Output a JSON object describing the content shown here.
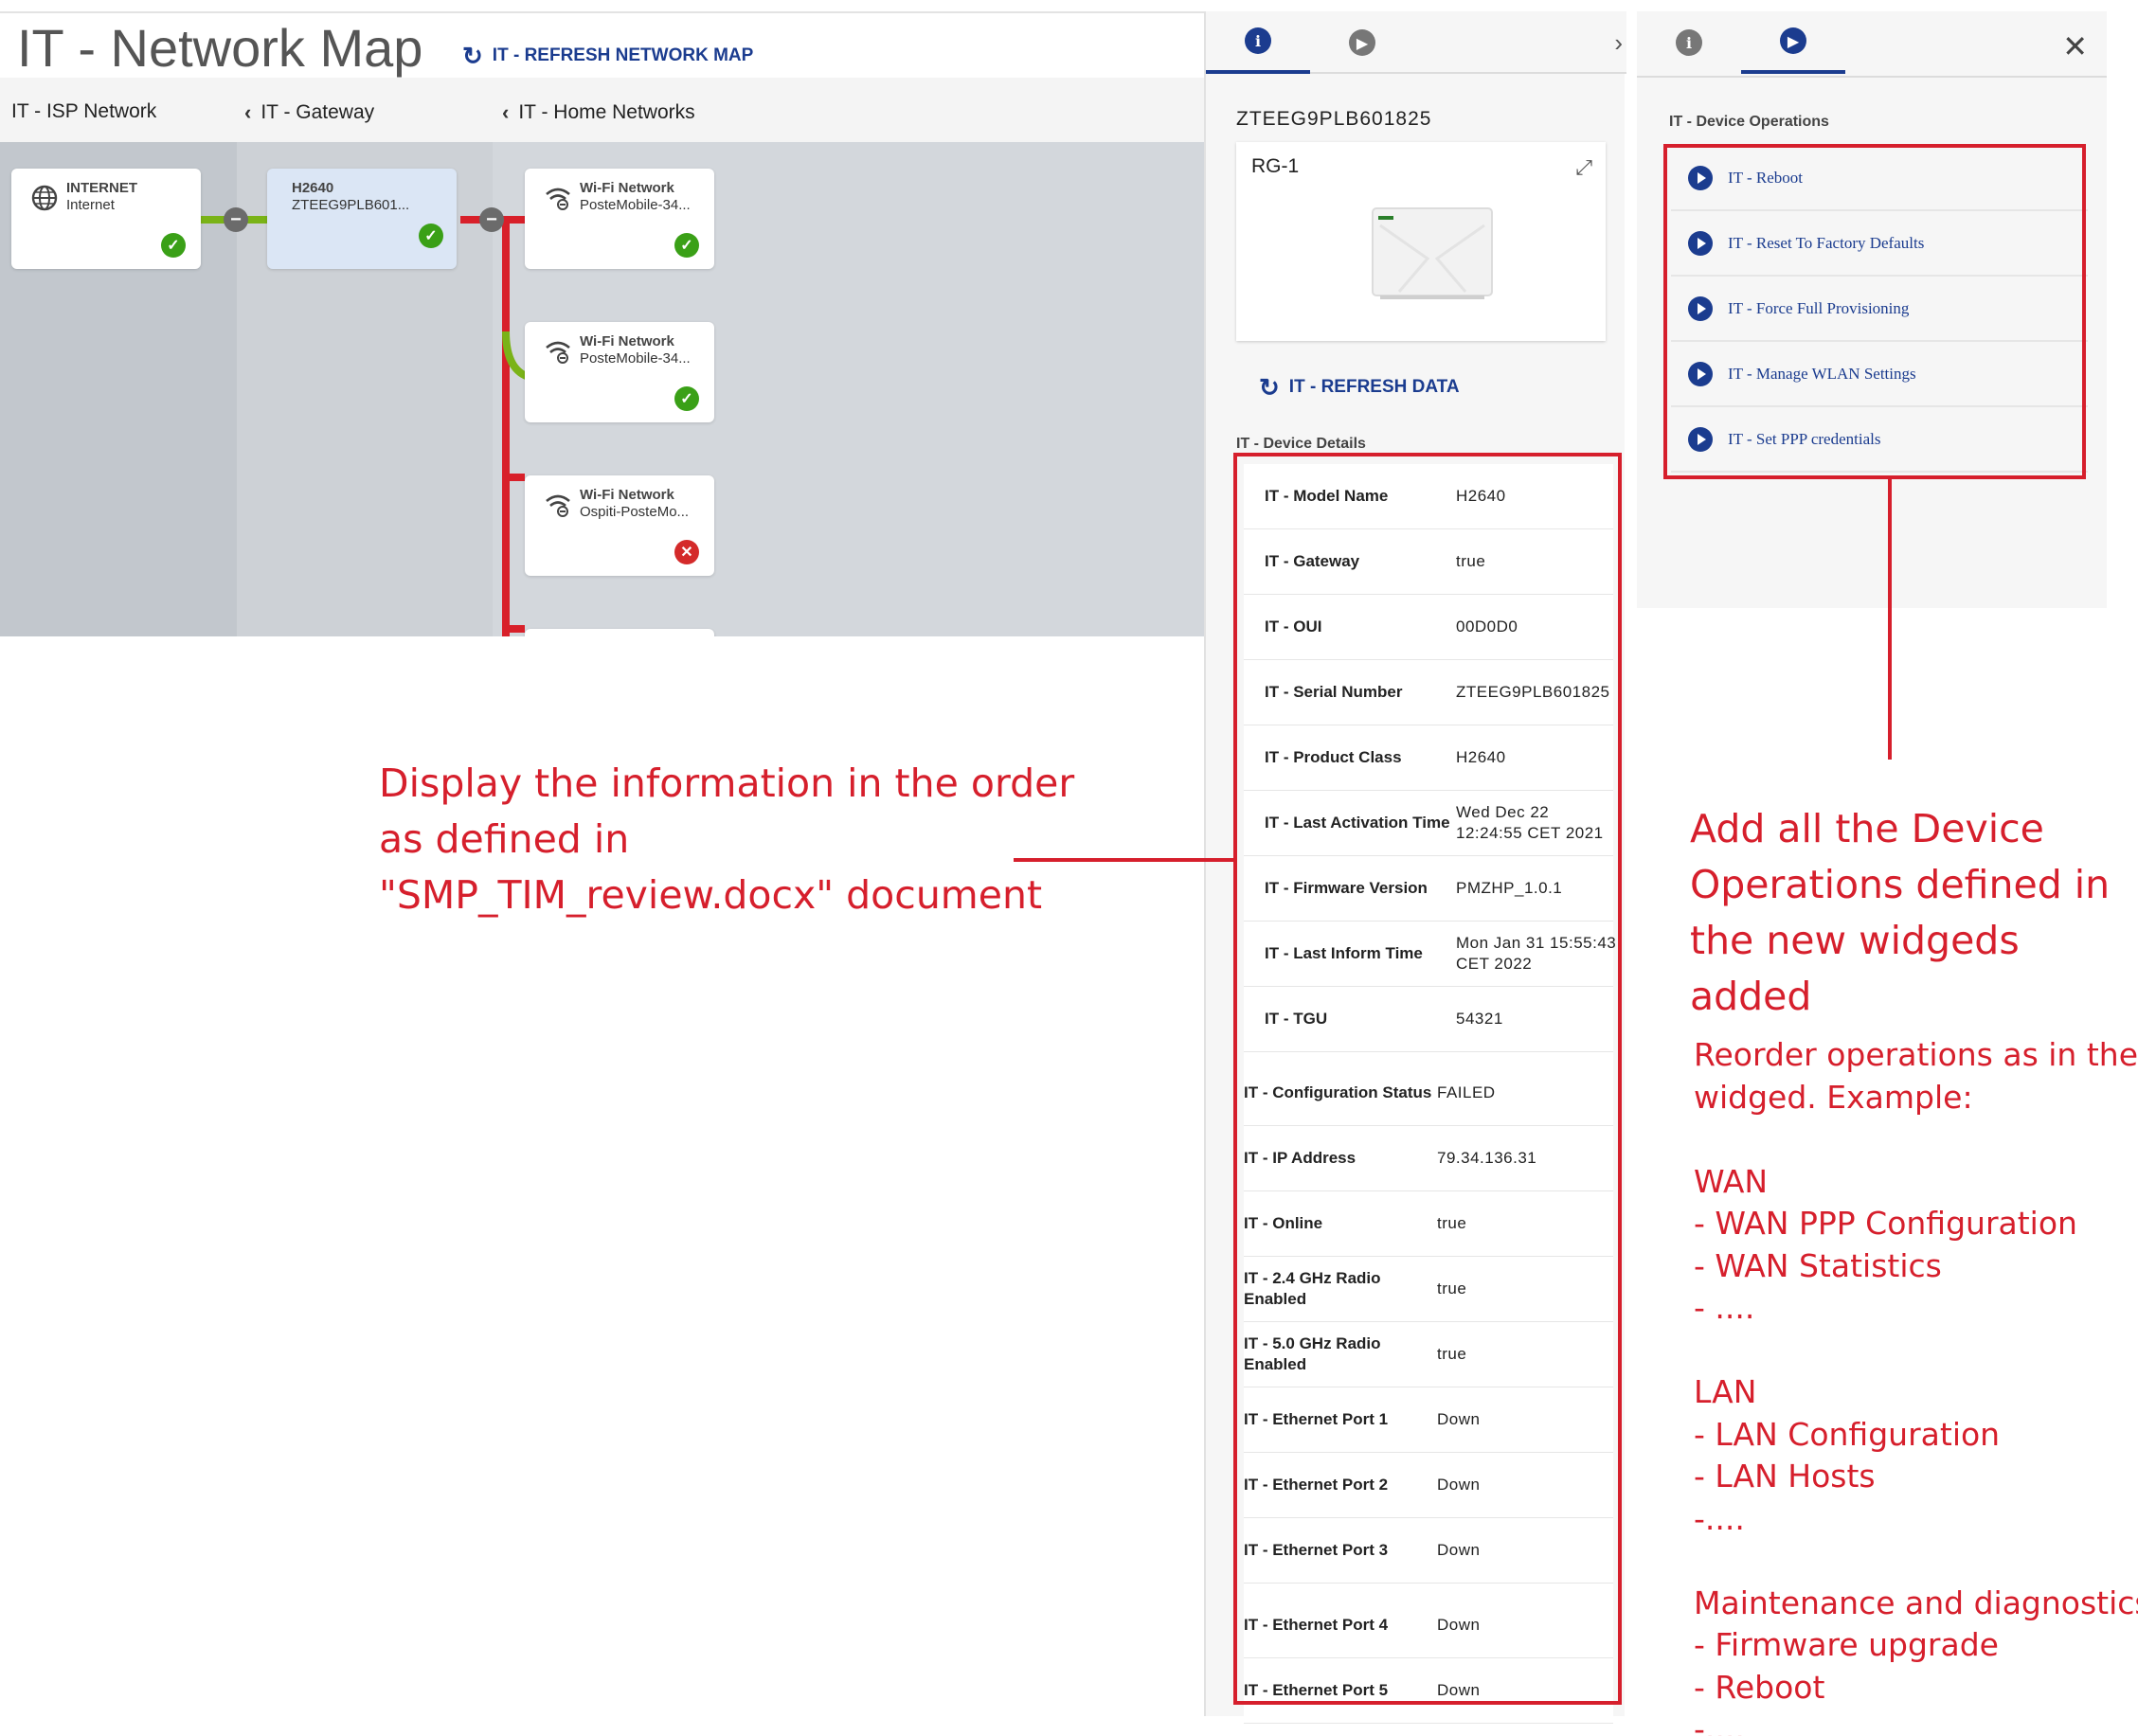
{
  "map": {
    "title": "IT - Network Map",
    "refresh_label": "IT - REFRESH NETWORK MAP",
    "columns": [
      {
        "label": "IT - ISP Network",
        "has_back": false
      },
      {
        "label": "IT - Gateway",
        "has_back": true
      },
      {
        "label": "IT - Home Networks",
        "has_back": true
      }
    ],
    "nodes": [
      {
        "title": "INTERNET",
        "subtitle": "Internet",
        "icon": "globe-icon",
        "status": "ok"
      },
      {
        "title": "H2640",
        "subtitle": "ZTEEG9PLB601...",
        "icon": "",
        "status": "ok",
        "selected": true
      },
      {
        "title": "Wi-Fi Network",
        "subtitle": "PosteMobile-34...",
        "icon": "wifi-icon",
        "status": "ok"
      },
      {
        "title": "Wi-Fi Network",
        "subtitle": "PosteMobile-34...",
        "icon": "wifi-icon",
        "status": "ok"
      },
      {
        "title": "Wi-Fi Network",
        "subtitle": "Ospiti-PosteMo...",
        "icon": "wifi-icon",
        "status": "error"
      }
    ],
    "colors": {
      "ok_line": "#7ab317",
      "error_line": "#d8202a",
      "accent": "#1b3c8f"
    }
  },
  "detail": {
    "serial": "ZTEEG9PLB601825",
    "card_title": "RG-1",
    "refresh_label": "IT - REFRESH DATA",
    "details_heading": "IT - Device Details",
    "rows": [
      {
        "label": "IT - Model Name",
        "value": "H2640"
      },
      {
        "label": "IT - Gateway",
        "value": "true"
      },
      {
        "label": "IT - OUI",
        "value": "00D0D0"
      },
      {
        "label": "IT - Serial Number",
        "value": "ZTEEG9PLB601825"
      },
      {
        "label": "IT - Product Class",
        "value": "H2640"
      },
      {
        "label": "IT - Last Activation Time",
        "value": "Wed Dec 22 12:24:55 CET 2021"
      },
      {
        "label": "IT - Firmware Version",
        "value": "PMZHP_1.0.1"
      },
      {
        "label": "IT - Last Inform Time",
        "value": "Mon Jan 31 15:55:43 CET 2022"
      },
      {
        "label": "IT - TGU",
        "value": "54321"
      },
      {
        "label": "IT - Configuration Status",
        "value": "FAILED"
      },
      {
        "label": "IT - IP Address",
        "value": "79.34.136.31"
      },
      {
        "label": "IT - Online",
        "value": "true"
      },
      {
        "label": "IT - 2.4 GHz Radio Enabled",
        "value": "true"
      },
      {
        "label": "IT - 5.0 GHz Radio Enabled",
        "value": "true"
      },
      {
        "label": "IT - Ethernet Port 1",
        "value": "Down"
      },
      {
        "label": "IT - Ethernet Port 2",
        "value": "Down"
      },
      {
        "label": "IT - Ethernet Port 3",
        "value": "Down"
      },
      {
        "label": "IT - Ethernet Port 4",
        "value": "Down"
      },
      {
        "label": "IT - Ethernet Port 5",
        "value": "Down"
      }
    ]
  },
  "operations": {
    "heading": "IT - Device Operations",
    "items": [
      {
        "label": "IT - Reboot"
      },
      {
        "label": "IT - Reset To Factory Defaults"
      },
      {
        "label": "IT - Force Full Provisioning"
      },
      {
        "label": "IT - Manage WLAN Settings"
      },
      {
        "label": "IT - Set PPP credentials"
      }
    ]
  },
  "annotations": {
    "order_note": [
      "Display the information in the order",
      "as defined in",
      "\"SMP_TIM_review.docx\" document"
    ],
    "ops_title": [
      "Add all the Device",
      "Operations defined in",
      "the new widgeds",
      "added"
    ],
    "ops_body": [
      "Reorder operations as in the",
      "widged. Example:",
      "",
      "WAN",
      "- WAN PPP Configuration",
      "- WAN Statistics",
      "- ....",
      "",
      "LAN",
      "- LAN Configuration",
      "- LAN Hosts",
      "-....",
      "",
      "Maintenance and diagnostics:",
      "- Firmware upgrade",
      "- Reboot",
      "-...."
    ],
    "color": "#d61f2c"
  }
}
